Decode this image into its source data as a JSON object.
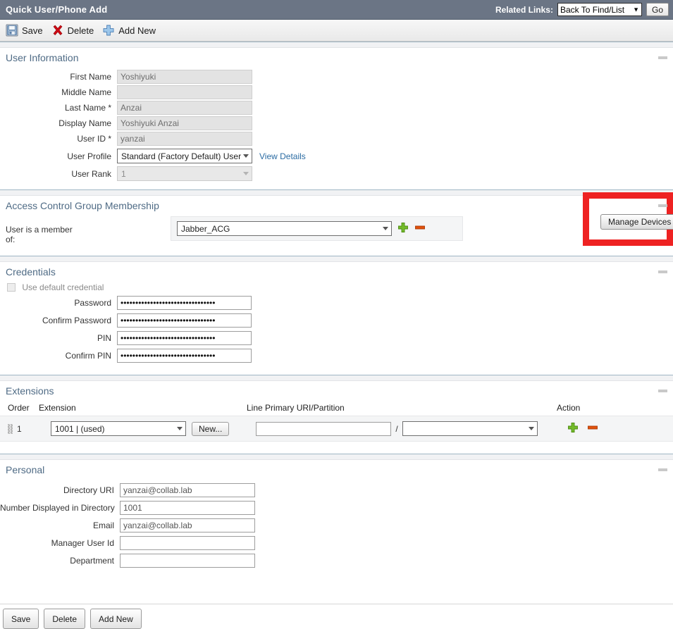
{
  "header": {
    "title": "Quick User/Phone Add",
    "related_links_label": "Related Links:",
    "related_links_value": "Back To Find/List",
    "go_label": "Go"
  },
  "toolbar": {
    "save_label": "Save",
    "delete_label": "Delete",
    "add_new_label": "Add New"
  },
  "user_information": {
    "section_title": "User Information",
    "first_name_label": "First Name",
    "first_name_value": "Yoshiyuki",
    "middle_name_label": "Middle Name",
    "middle_name_value": "",
    "last_name_label": "Last Name *",
    "last_name_value": "Anzai",
    "display_name_label": "Display Name",
    "display_name_value": "Yoshiyuki Anzai",
    "user_id_label": "User ID *",
    "user_id_value": "yanzai",
    "user_profile_label": "User Profile",
    "user_profile_value": "Standard (Factory Default) User",
    "view_details_label": "View Details",
    "user_rank_label": "User Rank",
    "user_rank_value": "1",
    "manage_devices_label": "Manage Devices"
  },
  "access_control_group": {
    "section_title": "Access Control Group Membership",
    "member_of_label": "User is a member of:",
    "group_value": "Jabber_ACG"
  },
  "credentials": {
    "section_title": "Credentials",
    "use_default_label": "Use default credential",
    "use_default_checked": false,
    "password_label": "Password",
    "password_value": "••••••••••••••••••••••••••••••••",
    "confirm_password_label": "Confirm Password",
    "confirm_password_value": "••••••••••••••••••••••••••••••••",
    "pin_label": "PIN",
    "pin_value": "••••••••••••••••••••••••••••••••",
    "confirm_pin_label": "Confirm PIN",
    "confirm_pin_value": "••••••••••••••••••••••••••••••••"
  },
  "extensions": {
    "section_title": "Extensions",
    "columns": {
      "order": "Order",
      "extension": "Extension",
      "line_primary_uri": "Line Primary URI/Partition",
      "action": "Action"
    },
    "rows": [
      {
        "order": "1",
        "extension": "1001 | (used)",
        "new_label": "New...",
        "uri_value": "",
        "separator": "/",
        "partition_value": ""
      }
    ]
  },
  "personal": {
    "section_title": "Personal",
    "directory_uri_label": "Directory URI",
    "directory_uri_value": "yanzai@collab.lab",
    "number_displayed_label": "Number Displayed in Directory",
    "number_displayed_value": "1001",
    "email_label": "Email",
    "email_value": "yanzai@collab.lab",
    "manager_user_id_label": "Manager User Id",
    "manager_user_id_value": "",
    "department_label": "Department",
    "department_value": ""
  },
  "footer": {
    "save_label": "Save",
    "delete_label": "Delete",
    "add_new_label": "Add New"
  },
  "colors": {
    "titlebar": "#6b7585",
    "section_title": "#4f6b85",
    "link": "#2b6ca3",
    "highlight_box": "#ee2222",
    "add_icon": "#6ab023",
    "remove_icon": "#d4500f"
  }
}
